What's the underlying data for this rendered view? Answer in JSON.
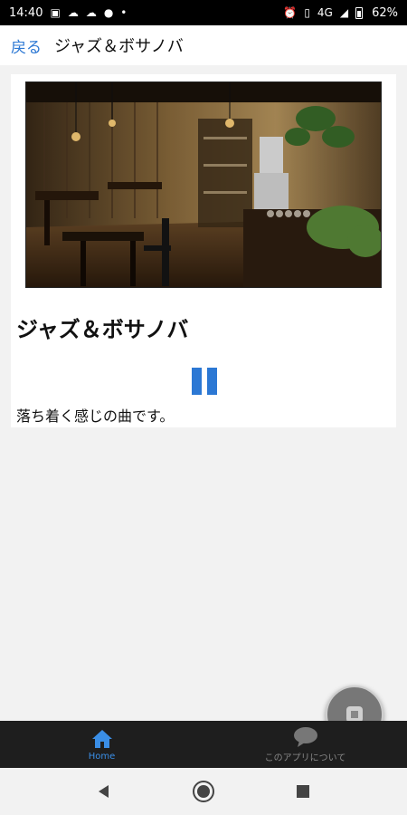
{
  "status_bar": {
    "time": "14:40",
    "signal_text": "4G",
    "battery": "62%"
  },
  "header": {
    "back_label": "戻る",
    "title": "ジャズ＆ボサノバ"
  },
  "card": {
    "title": "ジャズ＆ボサノバ",
    "description": "落ち着く感じの曲です。",
    "playback_state": "playing"
  },
  "tabs": [
    {
      "label": "Home",
      "icon": "home-icon",
      "active": true
    },
    {
      "label": "このアプリについて",
      "icon": "chat-bubble-icon",
      "active": false
    }
  ],
  "colors": {
    "accent": "#2c78d4",
    "tab_active": "#3a8ee6",
    "tabbar_bg": "#1e1e1e"
  }
}
